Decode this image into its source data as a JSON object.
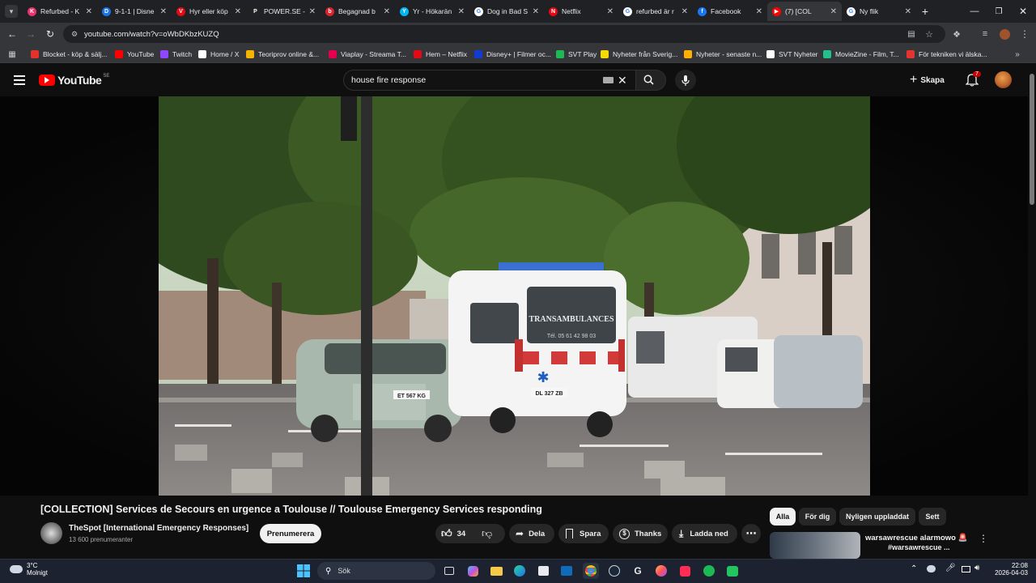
{
  "browser": {
    "tabs": [
      {
        "label": "Refurbed - K",
        "color": "#e8336b",
        "glyph": "K"
      },
      {
        "label": "9-1-1 | Disne",
        "color": "#1a73e8",
        "glyph": "D"
      },
      {
        "label": "Hyr eller köp",
        "color": "#e50914",
        "glyph": "V"
      },
      {
        "label": "POWER.SE -",
        "color": "#222222",
        "glyph": "P"
      },
      {
        "label": "Begagnad b",
        "color": "#d9232e",
        "glyph": "b"
      },
      {
        "label": "Yr - Hökarän",
        "color": "#00b8f1",
        "glyph": "Y"
      },
      {
        "label": "Dog in Bad S",
        "color": "#ffffff",
        "glyph": "G"
      },
      {
        "label": "Netflix",
        "color": "#e50914",
        "glyph": "N"
      },
      {
        "label": "refurbed är r",
        "color": "#ffffff",
        "glyph": "G"
      },
      {
        "label": "Facebook",
        "color": "#1877f2",
        "glyph": "f"
      },
      {
        "label": "(7) [COL",
        "color": "#ff0000",
        "glyph": "▶"
      },
      {
        "label": "Ny flik",
        "color": "#ffffff",
        "glyph": "G"
      }
    ],
    "url": "youtube.com/watch?v=oWbDKbzKUZQ",
    "bookmarks": [
      {
        "label": "Blocket - köp & sälj...",
        "color": "#e4312b"
      },
      {
        "label": "YouTube",
        "color": "#ff0000"
      },
      {
        "label": "Twitch",
        "color": "#9146ff"
      },
      {
        "label": "Home / X",
        "color": "#ffffff"
      },
      {
        "label": "Teoriprov online &...",
        "color": "#f4b400"
      },
      {
        "label": "Viaplay - Streama T...",
        "color": "#e5004d"
      },
      {
        "label": "Hem – Netflix",
        "color": "#e50914"
      },
      {
        "label": "Disney+ | Filmer oc...",
        "color": "#113ccf"
      },
      {
        "label": "SVT Play",
        "color": "#1db954"
      },
      {
        "label": "Nyheter från Sverig...",
        "color": "#f5d90a"
      },
      {
        "label": "Nyheter - senaste n...",
        "color": "#ffb000"
      },
      {
        "label": "SVT Nyheter",
        "color": "#ffffff"
      },
      {
        "label": "MovieZine - Film, T...",
        "color": "#22c08a"
      },
      {
        "label": "För tekniken vi älska...",
        "color": "#e3342f"
      }
    ]
  },
  "youtube": {
    "logo_text": "YouTube",
    "region": "SE",
    "search_value": "house fire response",
    "create_label": "Skapa",
    "notification_count": "7",
    "video_title": "[COLLECTION] Services de Secours en urgence a Toulouse // Toulouse Emergency Services responding",
    "channel_name": "TheSpot [International Emergency Responses]",
    "subscribers": "13 600 prenumeranter",
    "subscribe_label": "Prenumerera",
    "like_count": "34",
    "share_label": "Dela",
    "save_label": "Spara",
    "thanks_label": "Thanks",
    "download_label": "Ladda ned",
    "chips": [
      "Alla",
      "För dig",
      "Nyligen uppladdat",
      "Sett"
    ],
    "rec_title": "warsawrescue alarmowo 🚨",
    "rec_channel": "#warsawrescue ...",
    "ambulance_text": "TRANSAMBULANCES",
    "ambulance_sub": "Tél. 05 61 42 98 03",
    "plate_car": "ET 567 KG",
    "plate_amb": "DL 327 ZB"
  },
  "taskbar": {
    "weather_temp": "3°C",
    "weather_desc": "Molnigt",
    "search_label": "Sök",
    "time": "22:08",
    "date": "2026-04-03"
  },
  "colors": {
    "accent_red": "#ff0000",
    "bg": "#0f0f0f",
    "chip_active": "#f1f1f1"
  }
}
